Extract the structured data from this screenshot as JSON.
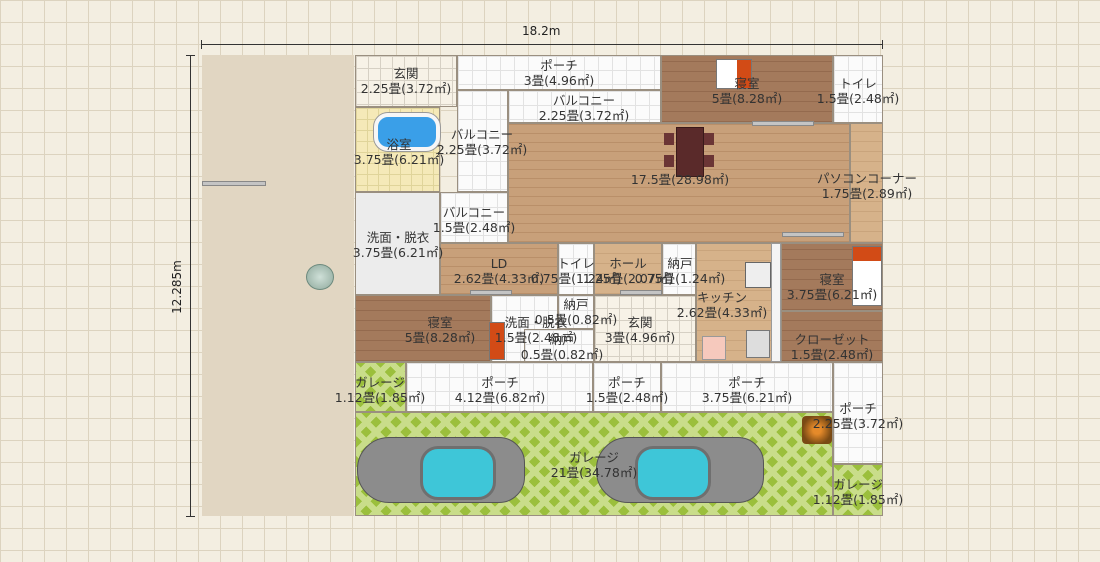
{
  "dimensions": {
    "width": "18.2m",
    "height": "12.285m"
  },
  "rooms": {
    "entrance_top": {
      "name": "玄関",
      "area": "2.25畳(3.72㎡)"
    },
    "porch_top": {
      "name": "ポーチ",
      "area": "3畳(4.96㎡)"
    },
    "bedroom_top": {
      "name": "寝室",
      "area": "5畳(8.28㎡)"
    },
    "toilet_top": {
      "name": "トイレ",
      "area": "1.5畳(2.48㎡)"
    },
    "balcony_1": {
      "name": "バルコニー",
      "area": "2.25畳(3.72㎡)"
    },
    "bath": {
      "name": "浴室",
      "area": "3.75畳(6.21㎡)"
    },
    "balcony_2": {
      "name": "バルコニー",
      "area": "2.25畳(3.72㎡)"
    },
    "dining": {
      "name": "",
      "area": "17.5畳(28.98㎡)"
    },
    "pc_corner": {
      "name": "パソコンコーナー",
      "area": "1.75畳(2.89㎡)"
    },
    "balcony_3": {
      "name": "バルコニー",
      "area": "1.5畳(2.48㎡)"
    },
    "washroom_1": {
      "name": "洗面・脱衣",
      "area": "3.75畳(6.21㎡)"
    },
    "ld": {
      "name": "LD",
      "area": "2.62畳(4.33㎡)"
    },
    "toilet_mid": {
      "name": "トイレ",
      "area": "0.75畳(1.24㎡)"
    },
    "hall": {
      "name": "ホール",
      "area": "1.25畳(2.07㎡)"
    },
    "storage_1": {
      "name": "納戸",
      "area": "0.75畳(1.24㎡)"
    },
    "kitchen": {
      "name": "キッチン",
      "area": "2.62畳(4.33㎡)"
    },
    "bedroom_right": {
      "name": "寝室",
      "area": "3.75畳(6.21㎡)"
    },
    "bedroom_left": {
      "name": "寝室",
      "area": "5畳(8.28㎡)"
    },
    "washroom_2": {
      "name": "洗面・脱衣",
      "area": "1.5畳(2.48㎡)"
    },
    "storage_2": {
      "name": "納戸",
      "area": "0.5畳(0.82㎡)"
    },
    "storage_3": {
      "name": "納戸",
      "area": "0.5畳(0.82㎡)"
    },
    "entrance_mid": {
      "name": "玄関",
      "area": "3畳(4.96㎡)"
    },
    "closet": {
      "name": "クローゼット",
      "area": "1.5畳(2.48㎡)"
    },
    "garage_small_l": {
      "name": "ガレージ",
      "area": "1.12畳(1.85㎡)"
    },
    "porch_1": {
      "name": "ポーチ",
      "area": "4.12畳(6.82㎡)"
    },
    "porch_2": {
      "name": "ポーチ",
      "area": "1.5畳(2.48㎡)"
    },
    "porch_3": {
      "name": "ポーチ",
      "area": "3.75畳(6.21㎡)"
    },
    "porch_4": {
      "name": "ポーチ",
      "area": "2.25畳(3.72㎡)"
    },
    "garage_main": {
      "name": "ガレージ",
      "area": "21畳(34.78㎡)"
    },
    "garage_small_r": {
      "name": "ガレージ",
      "area": "1.12畳(1.85㎡)"
    }
  },
  "colors": {
    "car_body": "#8c8c8c",
    "car_glass": "#3ec6d8",
    "grass": "#9bbf3c",
    "wood": "#c8a07a"
  }
}
